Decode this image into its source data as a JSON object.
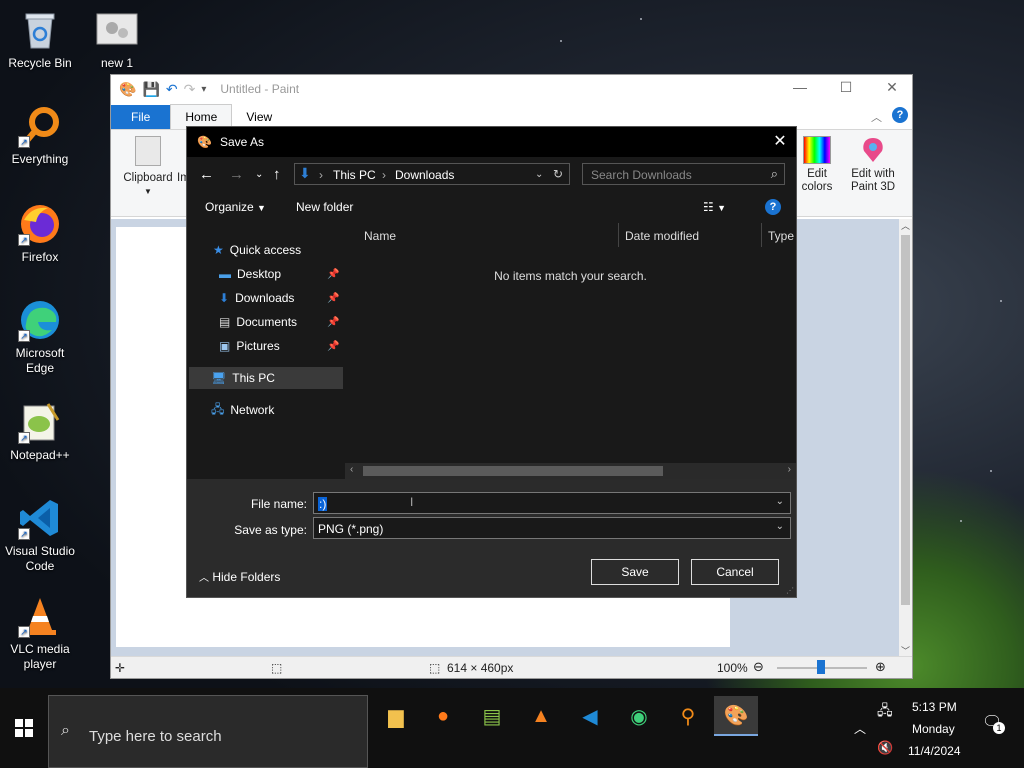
{
  "desktop": {
    "icons": [
      {
        "label": "Recycle Bin"
      },
      {
        "label": "new 1"
      },
      {
        "label": "Everything"
      },
      {
        "label": "Firefox"
      },
      {
        "label": "Microsoft Edge"
      },
      {
        "label": "Notepad++"
      },
      {
        "label": "Visual Studio Code"
      },
      {
        "label": "VLC media player"
      }
    ]
  },
  "paint": {
    "title": "Untitled - Paint",
    "tabs": [
      "File",
      "Home",
      "View"
    ],
    "ribbon": {
      "clipboard": "Clipboard",
      "image_partial": "Im",
      "edit_colors_1": "Edit",
      "edit_colors_2": "colors",
      "paint3d_1": "Edit with",
      "paint3d_2": "Paint 3D"
    },
    "status": {
      "dimensions": "614 × 460px",
      "zoom": "100%"
    }
  },
  "dialog": {
    "title": "Save As",
    "address": {
      "part1": "This PC",
      "part2": "Downloads"
    },
    "search_placeholder": "Search Downloads",
    "organize": "Organize",
    "new_folder": "New folder",
    "nav": {
      "quick_access": "Quick access",
      "desktop": "Desktop",
      "downloads": "Downloads",
      "documents": "Documents",
      "pictures": "Pictures",
      "this_pc": "This PC",
      "network": "Network"
    },
    "columns": {
      "name": "Name",
      "date": "Date modified",
      "type": "Type"
    },
    "empty_message": "No items match your search.",
    "file_name_label": "File name:",
    "file_name_value": ":)",
    "save_type_label": "Save as type:",
    "save_type_value": "PNG (*.png)",
    "save_button": "Save",
    "cancel_button": "Cancel",
    "hide_folders": "Hide Folders"
  },
  "taskbar": {
    "search_placeholder": "Type here to search",
    "time": "5:13 PM",
    "day": "Monday",
    "date": "11/4/2024",
    "notification_count": "1"
  },
  "colors": {
    "accent": "#1a73d1",
    "dialog_bg": "#2b2b2b",
    "dialog_pane": "#191919",
    "selection": "#0a64d8"
  }
}
